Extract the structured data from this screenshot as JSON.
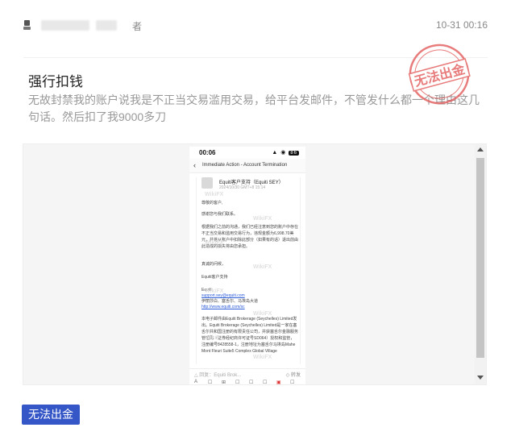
{
  "post": {
    "author_suffix": "者",
    "timestamp": "10-31 00:16",
    "title": "强行扣钱",
    "body": "无故封禁我的账户说我是不正当交易滥用交易，给平台发邮件，不管发什么都一个理由这几句话。然后扣了我9000多刀",
    "stamp_text": "无法出金",
    "badge_label": "无法出金"
  },
  "screenshot": {
    "status_time": "00:06",
    "status_icons": "▲ ◉",
    "battery": "86",
    "back_icon": "‹",
    "nav_title": "Immediate Action - Account Termination",
    "sender": "Equiti客户支持（Equiti SEY）",
    "sent_date": "2024/10/30 GMT+8 15:14",
    "greeting": "尊敬的客户,",
    "thanks": "感谢您与我们联系。",
    "paragraph": "根据我们之前的沟通，我们已经注意到您的账户中存在不正当交易和滥用交易行为，违规金额为6,998.70美元，并将从账户中扣除此部分（如果有的话）退出前由此造成的损失将由您承担。",
    "regards": "真诚的问候，",
    "team": "Equiti客户支持",
    "company": "Equiti",
    "email_link": "support.sey@equiti.com",
    "address_line": "伊丽莎白、塞舌尔、马埃岛大道",
    "website_link": "http://www.equiti.com/sc",
    "legal": "本电子邮件由Equiti Brokerage (Seychelles) Limited发出。Equiti Brokerage (Seychelles) Limited是一家在塞舌尔共和国注册的有限责任公司，并获塞舌尔金融服务管理局（证券经纪商许可证号SD064）授权和监管，注册编号8428558-1，注册地址为塞舌尔马埃岛Mahe Mont Fleuri Suite5 Complex Global Village",
    "reply_placeholder": "△ 回复：Equiti Brok...",
    "reply_button": "◇ 转发",
    "watermarks": [
      "WikiFX",
      "WikiFX",
      "WikiFX",
      "WikiFX",
      "WikiFX",
      "WikiFX",
      "WikiFX",
      "WikiFX"
    ],
    "toolbar": [
      "A",
      "☐",
      "⊞",
      "☐",
      "☐",
      "☐",
      "▣",
      "☐"
    ]
  }
}
